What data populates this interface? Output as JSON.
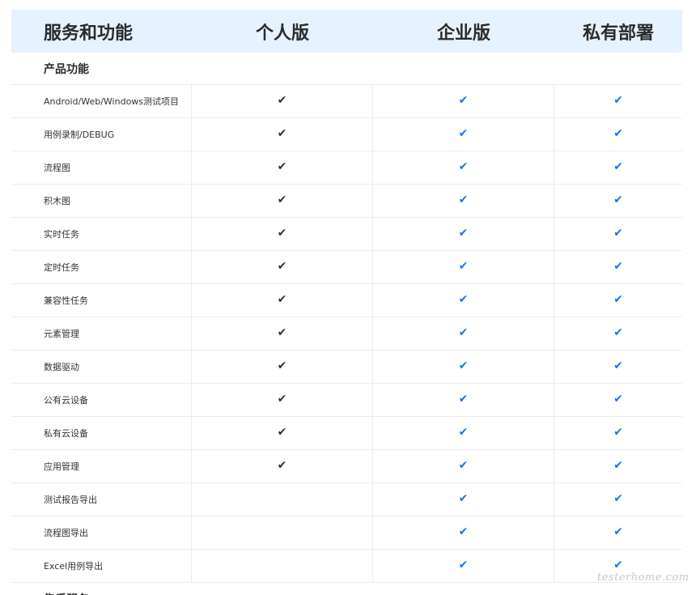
{
  "header": {
    "col1": "服务和功能",
    "col2": "个人版",
    "col3": "企业版",
    "col4": "私有部署"
  },
  "section": {
    "title": "产品功能"
  },
  "rows": [
    {
      "feature": "Android/Web/Windows测试项目",
      "personal": true,
      "enterprise": true,
      "private": true
    },
    {
      "feature": "用例录制/DEBUG",
      "personal": true,
      "enterprise": true,
      "private": true
    },
    {
      "feature": "流程图",
      "personal": true,
      "enterprise": true,
      "private": true
    },
    {
      "feature": "积木图",
      "personal": true,
      "enterprise": true,
      "private": true
    },
    {
      "feature": "实时任务",
      "personal": true,
      "enterprise": true,
      "private": true
    },
    {
      "feature": "定时任务",
      "personal": true,
      "enterprise": true,
      "private": true
    },
    {
      "feature": "兼容性任务",
      "personal": true,
      "enterprise": true,
      "private": true
    },
    {
      "feature": "元素管理",
      "personal": true,
      "enterprise": true,
      "private": true
    },
    {
      "feature": "数据驱动",
      "personal": true,
      "enterprise": true,
      "private": true
    },
    {
      "feature": "公有云设备",
      "personal": true,
      "enterprise": true,
      "private": true
    },
    {
      "feature": "私有云设备",
      "personal": true,
      "enterprise": true,
      "private": true
    },
    {
      "feature": "应用管理",
      "personal": true,
      "enterprise": true,
      "private": true
    },
    {
      "feature": "测试报告导出",
      "personal": false,
      "enterprise": true,
      "private": true
    },
    {
      "feature": "流程图导出",
      "personal": false,
      "enterprise": true,
      "private": true
    },
    {
      "feature": "Excel用例导出",
      "personal": false,
      "enterprise": true,
      "private": true
    }
  ],
  "check_glyph": "✔",
  "colors": {
    "header_bg": "#e6f2fe",
    "check_personal": "#333333",
    "check_paid": "#1976e0",
    "divider": "#ececec"
  },
  "next_section": {
    "title": "售后服务"
  },
  "watermark": "testerhome.com"
}
